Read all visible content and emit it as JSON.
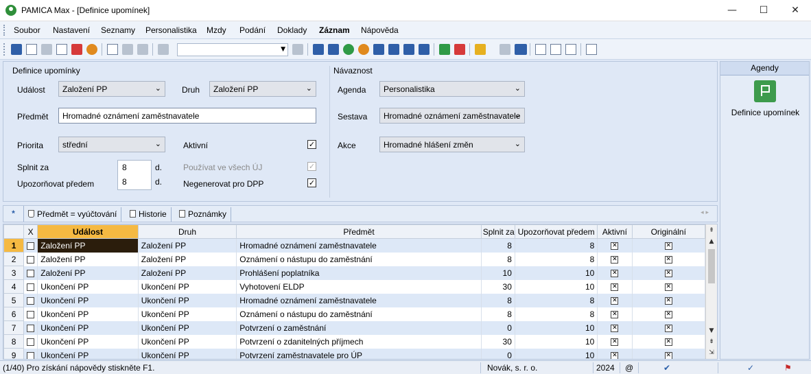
{
  "window": {
    "title": "PAMICA Max - [Definice upomínek]",
    "min_glyph": "—",
    "max_glyph": "☐",
    "close_glyph": "✕"
  },
  "menu": [
    "Soubor",
    "Nastavení",
    "Seznamy",
    "Personalistika",
    "Mzdy",
    "Podání",
    "Doklady",
    "Záznam",
    "Nápověda"
  ],
  "toolbar": {
    "combo_value": "",
    "dropdown_glyph": "▼"
  },
  "form": {
    "section_title": "Definice upomínky",
    "udalost": {
      "label": "Událost",
      "value": "Založení PP"
    },
    "druh": {
      "label": "Druh",
      "value": "Založení PP"
    },
    "predmet": {
      "label": "Předmět",
      "value": "Hromadné oznámení zaměstnavatele"
    },
    "priorita": {
      "label": "Priorita",
      "value": "střední"
    },
    "aktivni": {
      "label": "Aktivní",
      "checked": true
    },
    "splnit_za": {
      "label": "Splnit za",
      "value": "8",
      "unit": "d."
    },
    "upozornovat": {
      "label": "Upozorňovat předem",
      "value": "8",
      "unit": "d."
    },
    "pouzivat": {
      "label": "Používat ve všech ÚJ",
      "checked": true,
      "disabled": true
    },
    "negenerovat": {
      "label": "Negenerovat pro DPP",
      "checked": true
    },
    "check_glyph": "✓",
    "combo_arrow": "⌄"
  },
  "navaznost": {
    "title": "Návaznost",
    "agenda": {
      "label": "Agenda",
      "value": "Personalistika"
    },
    "sestava": {
      "label": "Sestava",
      "value": "Hromadné oznámení zaměstnavatele"
    },
    "akce": {
      "label": "Akce",
      "value": "Hromadné hlášení změn"
    }
  },
  "agendy": {
    "header": "Agendy",
    "item_label": "Definice upomínek"
  },
  "tabs": {
    "star": "*",
    "filter": "Předmět = vyúčtování",
    "historie": "Historie",
    "poznamky": "Poznámky",
    "nav": "◂ ▸"
  },
  "grid": {
    "columns": [
      "",
      "X",
      "Událost",
      "Druh",
      "Předmět",
      "Splnit za",
      "Upozorňovat předem",
      "Aktivní",
      "Originální"
    ],
    "check_glyph": "✕",
    "rows": [
      {
        "n": "1",
        "udalost": "Založení PP",
        "druh": "Založení PP",
        "predmet": "Hromadné oznámení zaměstnavatele",
        "splnit": "8",
        "upoz": "8"
      },
      {
        "n": "2",
        "udalost": "Založení PP",
        "druh": "Založení PP",
        "predmet": "Oznámení o nástupu do zaměstnání",
        "splnit": "8",
        "upoz": "8"
      },
      {
        "n": "3",
        "udalost": "Založení PP",
        "druh": "Založení PP",
        "predmet": "Prohlášení poplatníka",
        "splnit": "10",
        "upoz": "10"
      },
      {
        "n": "4",
        "udalost": "Ukončení PP",
        "druh": "Ukončení PP",
        "predmet": "Vyhotovení ELDP",
        "splnit": "30",
        "upoz": "10"
      },
      {
        "n": "5",
        "udalost": "Ukončení PP",
        "druh": "Ukončení PP",
        "predmet": "Hromadné oznámení zaměstnavatele",
        "splnit": "8",
        "upoz": "8"
      },
      {
        "n": "6",
        "udalost": "Ukončení PP",
        "druh": "Ukončení PP",
        "predmet": "Oznámení o nástupu do zaměstnání",
        "splnit": "8",
        "upoz": "8"
      },
      {
        "n": "7",
        "udalost": "Ukončení PP",
        "druh": "Ukončení PP",
        "predmet": "Potvrzení o zaměstnání",
        "splnit": "0",
        "upoz": "10"
      },
      {
        "n": "8",
        "udalost": "Ukončení PP",
        "druh": "Ukončení PP",
        "predmet": "Potvrzení o zdanitelných příjmech",
        "splnit": "30",
        "upoz": "10"
      },
      {
        "n": "9",
        "udalost": "Ukončení PP",
        "druh": "Ukončení PP",
        "predmet": "Potvrzení zaměstnavatele pro ÚP",
        "splnit": "0",
        "upoz": "10"
      }
    ],
    "scroll_glyphs": [
      "⇞",
      "▲",
      "▼",
      "⇟",
      "⇲"
    ]
  },
  "status": {
    "help": "(1/40) Pro získání nápovědy stiskněte F1.",
    "company": "Novák, s. r. o.",
    "year": "2024",
    "at": "@",
    "check": "✔",
    "ok": "✓",
    "flag": "⚑"
  }
}
